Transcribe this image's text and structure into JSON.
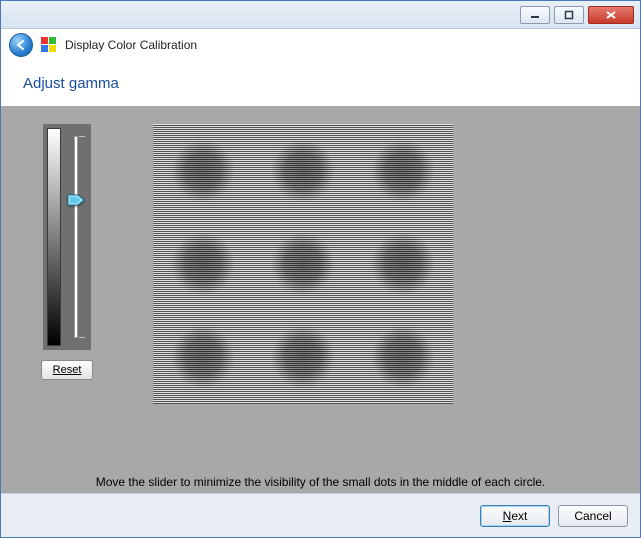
{
  "window": {
    "app_title": "Display Color Calibration"
  },
  "page": {
    "heading": "Adjust gamma",
    "reset_label": "Reset",
    "instruction": "Move the slider to minimize the visibility of the small dots in the middle of each circle.",
    "slider_value_percent": 33
  },
  "footer": {
    "next_label": "Next",
    "cancel_label": "Cancel"
  }
}
